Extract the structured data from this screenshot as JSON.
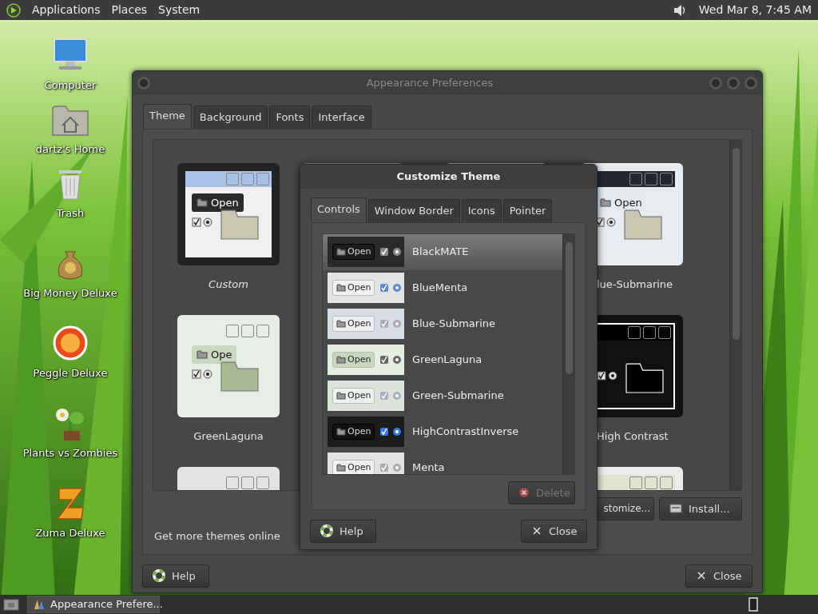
{
  "top_panel": {
    "menus": [
      "Applications",
      "Places",
      "System"
    ],
    "clock": "Wed Mar 8, 7:45 AM"
  },
  "desktop_icons": [
    {
      "label": "Computer",
      "kind": "computer"
    },
    {
      "label": "dartz's Home",
      "kind": "home"
    },
    {
      "label": "Trash",
      "kind": "trash"
    },
    {
      "label": "Big Money Deluxe",
      "kind": "money"
    },
    {
      "label": "Peggle Deluxe",
      "kind": "peggle"
    },
    {
      "label": "Plants vs Zombies",
      "kind": "plant"
    },
    {
      "label": "Zuma Deluxe",
      "kind": "zuma"
    }
  ],
  "appearance_window": {
    "title": "Appearance Preferences",
    "tabs": [
      {
        "label": "Theme",
        "selected": true
      },
      {
        "label": "Background",
        "selected": false
      },
      {
        "label": "Fonts",
        "selected": false
      },
      {
        "label": "Interface",
        "selected": false
      }
    ],
    "theme_rows": [
      [
        {
          "name": "Custom",
          "preview_label": "Open",
          "selected": true
        },
        {},
        {},
        {
          "name": "lue-Submarine",
          "preview_label": "Open",
          "selected": false
        }
      ],
      [
        {
          "name": "GreenLaguna",
          "preview_label": "Ope",
          "selected": false
        },
        {
          "name": "High Contrast",
          "selected": false
        }
      ],
      [
        {},
        {}
      ]
    ],
    "customize_button": "stomize...",
    "install_button": "Install...",
    "more_link": "Get more themes online",
    "help_button": "Help",
    "close_button": "Close"
  },
  "customize_dialog": {
    "title": "Customize Theme",
    "tabs": [
      {
        "label": "Controls",
        "selected": true
      },
      {
        "label": "Window Border",
        "selected": false
      },
      {
        "label": "Icons",
        "selected": false
      },
      {
        "label": "Pointer",
        "selected": false
      }
    ],
    "themes": [
      {
        "name": "BlackMATE",
        "preview_label": "Open",
        "selected": true
      },
      {
        "name": "BlueMenta",
        "preview_label": "Open",
        "selected": false
      },
      {
        "name": "Blue-Submarine",
        "preview_label": "Open",
        "selected": false
      },
      {
        "name": "GreenLaguna",
        "preview_label": "Open",
        "selected": false
      },
      {
        "name": "Green-Submarine",
        "preview_label": "Open",
        "selected": false
      },
      {
        "name": "HighContrastInverse",
        "preview_label": "Open",
        "selected": false
      },
      {
        "name": "Menta",
        "preview_label": "Open",
        "selected": false
      }
    ],
    "delete_button": {
      "label": "Delete",
      "disabled": true
    },
    "help_button": "Help",
    "close_button": "Close"
  },
  "taskbar": {
    "tasks": [
      {
        "label": "Appearance Prefere...",
        "selected": true
      }
    ]
  }
}
